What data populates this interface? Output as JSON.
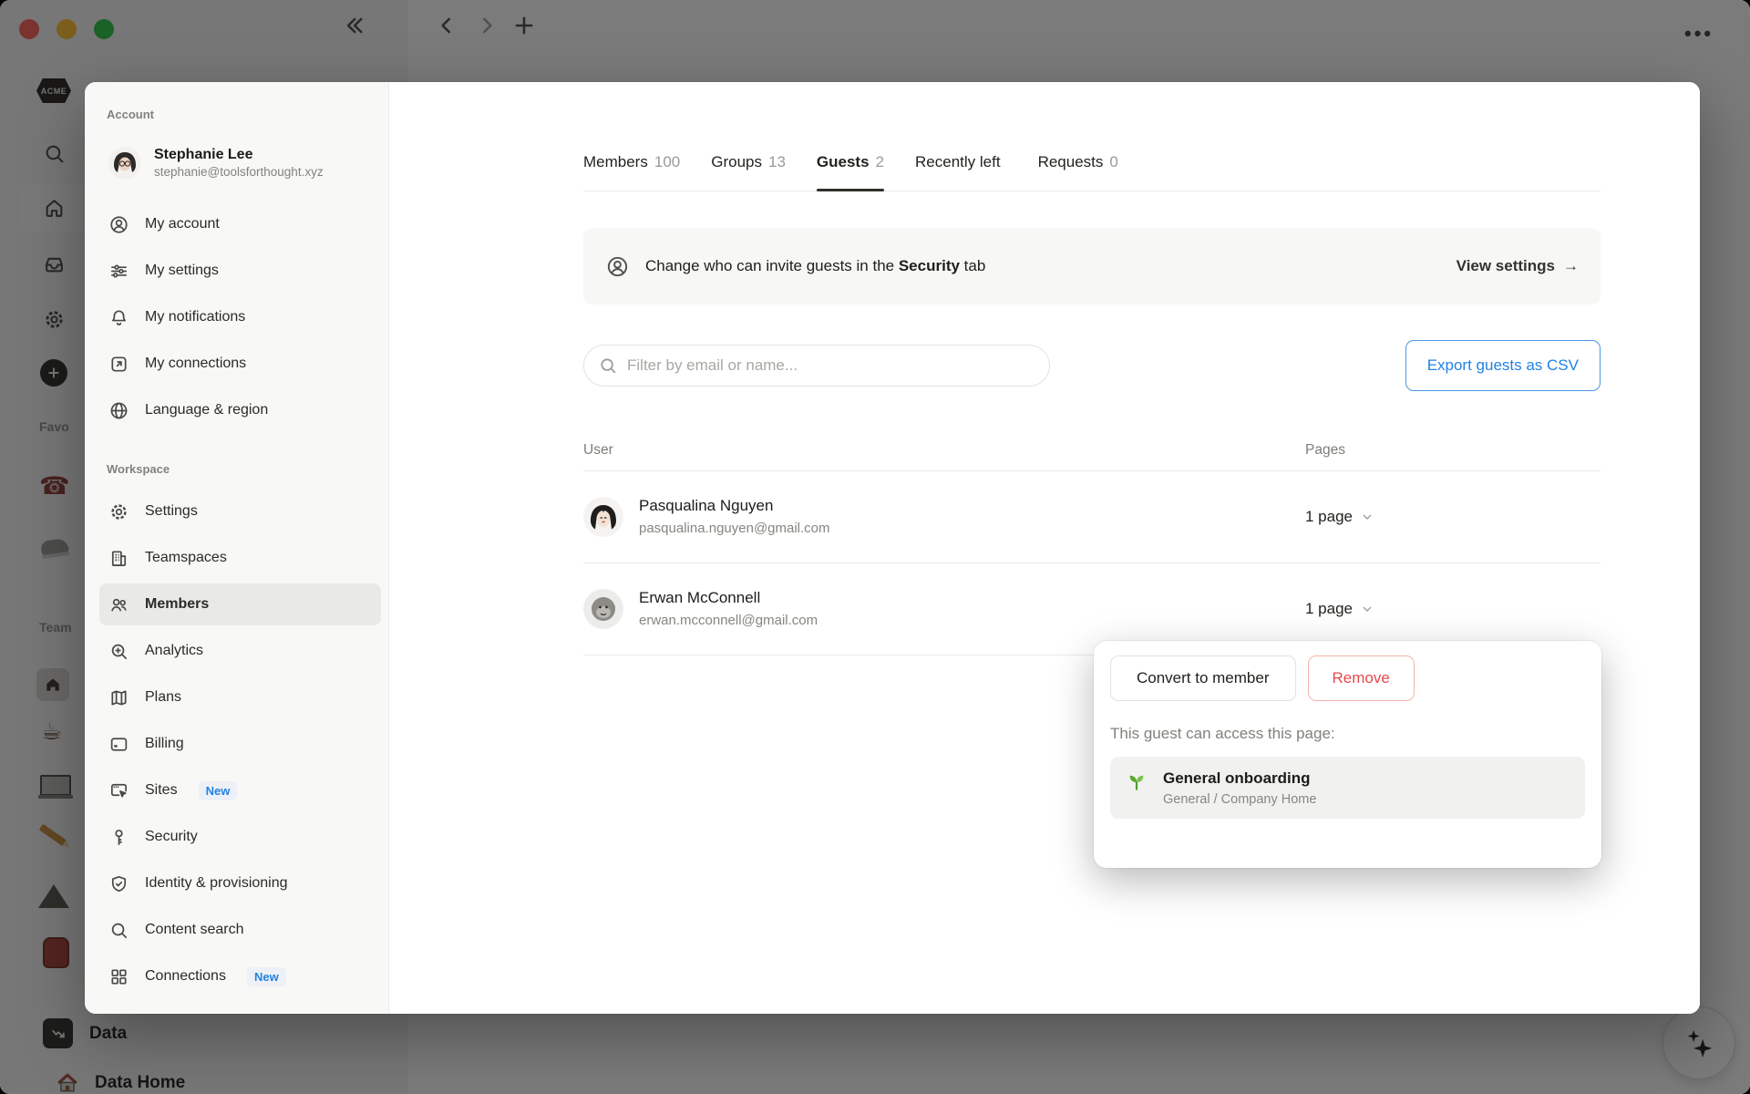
{
  "window": {
    "traffic_lights": [
      "close",
      "minimize",
      "zoom"
    ],
    "more_label": "•••"
  },
  "app": {
    "logo_text": "ACME",
    "favorites_label": "Favo",
    "teamspaces_label": "Team",
    "bottom_items": [
      {
        "label": "Data"
      },
      {
        "label": "Data Home"
      }
    ]
  },
  "modal": {
    "sidebar": {
      "account_label": "Account",
      "user": {
        "name": "Stephanie Lee",
        "email": "stephanie@toolsforthought.xyz"
      },
      "account_items": [
        {
          "label": "My account"
        },
        {
          "label": "My settings"
        },
        {
          "label": "My notifications"
        },
        {
          "label": "My connections"
        },
        {
          "label": "Language & region"
        }
      ],
      "workspace_label": "Workspace",
      "workspace_items": [
        {
          "label": "Settings"
        },
        {
          "label": "Teamspaces"
        },
        {
          "label": "Members",
          "selected": true
        },
        {
          "label": "Analytics"
        },
        {
          "label": "Plans"
        },
        {
          "label": "Billing"
        },
        {
          "label": "Sites",
          "badge": "New"
        },
        {
          "label": "Security"
        },
        {
          "label": "Identity & provisioning"
        },
        {
          "label": "Content search"
        },
        {
          "label": "Connections",
          "badge": "New"
        }
      ]
    },
    "main": {
      "tabs": [
        {
          "label": "Members",
          "count": "100"
        },
        {
          "label": "Groups",
          "count": "13"
        },
        {
          "label": "Guests",
          "count": "2",
          "active": true
        },
        {
          "label": "Recently left",
          "count": ""
        },
        {
          "label": "Requests",
          "count": "0"
        }
      ],
      "banner": {
        "text_before": "Change who can invite guests in the ",
        "text_bold": "Security",
        "text_after": " tab",
        "action": "View settings",
        "arrow": "→"
      },
      "filter_placeholder": "Filter by email or name...",
      "export_label": "Export guests as CSV",
      "table": {
        "col_user": "User",
        "col_pages": "Pages",
        "rows": [
          {
            "name": "Pasqualina Nguyen",
            "email": "pasqualina.nguyen@gmail.com",
            "pages": "1 page"
          },
          {
            "name": "Erwan McConnell",
            "email": "erwan.mcconnell@gmail.com",
            "pages": "1 page"
          }
        ]
      }
    }
  },
  "popover": {
    "convert_label": "Convert to member",
    "remove_label": "Remove",
    "caption": "This guest can access this page:",
    "page": {
      "title": "General onboarding",
      "path": "General / Company Home"
    }
  },
  "colors": {
    "accent_blue": "#2383e2",
    "danger_red": "#e5484d",
    "banner_bg": "#f7f7f5",
    "selected_bg": "#e9e9e6",
    "overlay": "rgba(15,15,15,0.55)"
  }
}
